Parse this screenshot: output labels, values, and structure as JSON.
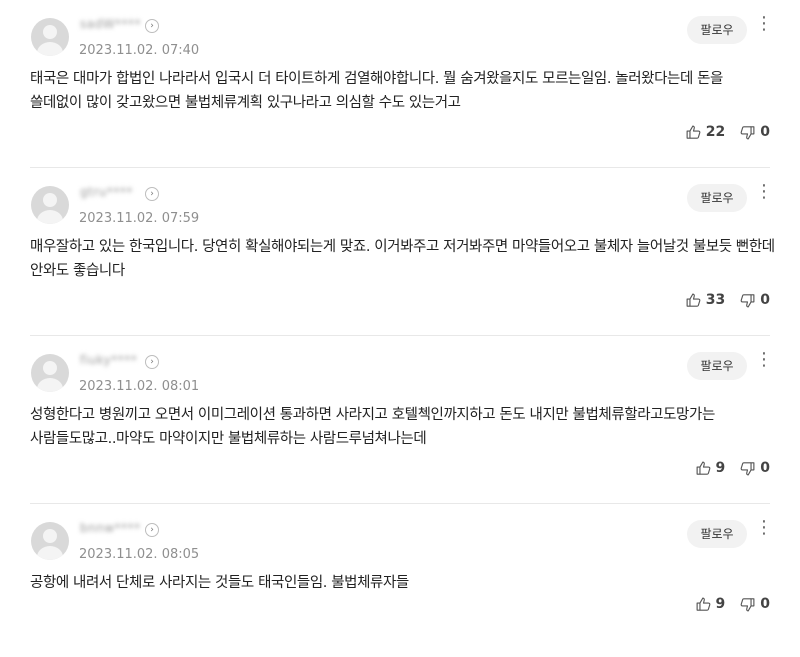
{
  "comments": [
    {
      "nickname": "sadW****",
      "date": "2023.11.02. 07:40",
      "follow_label": "팔로우",
      "text": "태국은 대마가 합법인 나라라서 입국시 더 타이트하게 검열해야합니다. 뭘 숨겨왔을지도 모르는일임. 놀러왔다는데 돈을 쓸데없이 많이 갖고왔으면 불법체류계획 있구나라고 의심할 수도 있는거고",
      "likes": "22",
      "dislikes": "0"
    },
    {
      "nickname": "gtru****",
      "date": "2023.11.02. 07:59",
      "follow_label": "팔로우",
      "text": "매우잘하고 있는 한국입니다. 당연히 확실해야되는게 맞죠. 이거봐주고 저거봐주면 마약들어오고 불체자 늘어날것 불보듯 뻔한데 안와도 좋습니다",
      "likes": "33",
      "dislikes": "0"
    },
    {
      "nickname": "fiuky****",
      "date": "2023.11.02. 08:01",
      "follow_label": "팔로우",
      "text": "성형한다고 병원끼고 오면서 이미그레이션 통과하면 사라지고 호텔첵인까지하고 돈도 내지만 불법체류할라고도망가는 사람들도많고..마약도 마약이지만 불법체류하는 사람드루넘쳐나는데",
      "likes": "9",
      "dislikes": "0"
    },
    {
      "nickname": "bnnw****",
      "date": "2023.11.02. 08:05",
      "follow_label": "팔로우",
      "text": "공항에 내려서 단체로 사라지는 것들도 태국인들임. 불법체류자들",
      "likes": "9",
      "dislikes": "0"
    }
  ]
}
